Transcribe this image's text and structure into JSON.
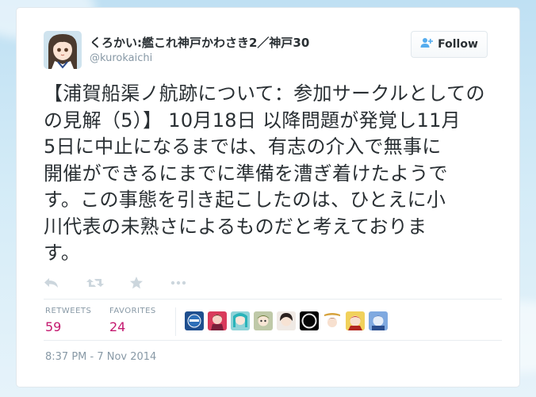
{
  "tweet": {
    "display_name": "くろかい:艦これ神戸かわさき2／神戸30",
    "handle": "@kurokaichi",
    "follow_label": "Follow",
    "text": "【浦賀船渠ノ航跡について:参加サークルとしての見解(5)】10月18日以降問題が発覚し11月5日に中止になるまでは、有志の介入で無事に開催ができるにまでに準備を漕ぎ着けたようです。この事態を引き起こしたのは、ひとえに小川代表の未熟さによるものだと考えております。",
    "text_lines": [
      "【浦賀船渠ノ航跡について：参加サークルとしての",
      "の見解（5）】 10月18日 以降問題が発覚し11月",
      "5日に中止になるまでは、有志の介入で無事に",
      "開催ができるにまでに準備を漕ぎ着けたようで",
      "す。この事態を引き起こしたのは、ひとえに小",
      "川代表の未熟さによるものだと考えておりま",
      "す。"
    ],
    "stats": {
      "retweets_label": "RETWEETS",
      "retweets_count": "59",
      "favorites_label": "FAVORITES",
      "favorites_count": "24"
    },
    "timestamp": "8:37 PM - 7 Nov 2014"
  },
  "actions": [
    {
      "name": "reply-icon"
    },
    {
      "name": "retweet-icon"
    },
    {
      "name": "favorite-star-icon"
    },
    {
      "name": "more-dots-icon"
    }
  ],
  "favorited_by_avatars": 10,
  "colors": {
    "text": "#292f33",
    "muted": "#8899a6",
    "stat_count": "#c4186f",
    "follow_icon": "#55acee",
    "action_icon": "#ccd6dd"
  }
}
